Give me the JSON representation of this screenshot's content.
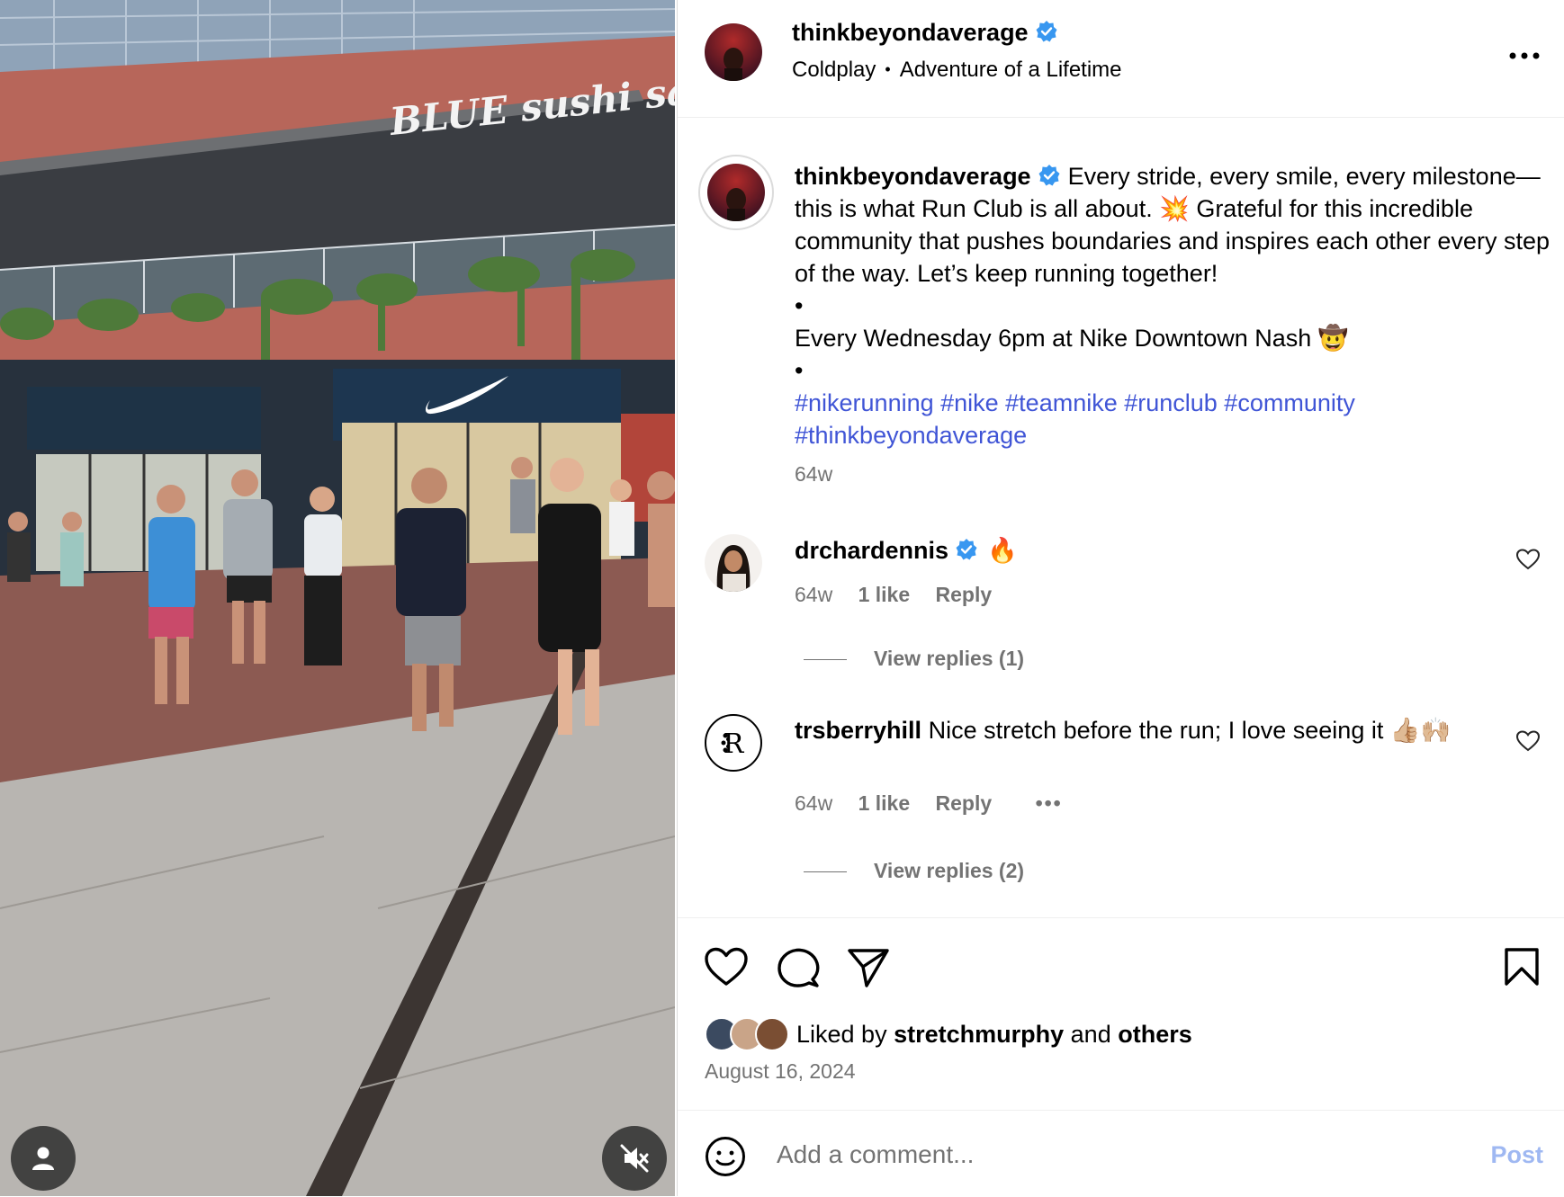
{
  "post": {
    "username": "thinkbeyondaverage",
    "verified": true,
    "audio_artist": "Coldplay",
    "audio_track": "Adventure of a Lifetime",
    "more_icon": "more-horizontal-icon",
    "storefront_sign": "BLUE sushi sake grill",
    "caption": {
      "username": "thinkbeyondaverage",
      "text": "Every stride, every smile, every milestone—this is what Run Club is all about. 💥 Grateful for this incredible community that pushes boundaries and inspires each other every step of the way. Let’s keep running together!",
      "bullet1": "•",
      "line2": "Every Wednesday 6pm at Nike Downtown Nash 🤠",
      "bullet2": "•",
      "hashtags": "#nikerunning #nike #teamnike #runclub #community #thinkbeyondaverage",
      "time": "64w"
    },
    "comments": [
      {
        "username": "drchardennis",
        "verified": true,
        "text": "🔥",
        "time": "64w",
        "likes": "1 like",
        "reply_label": "Reply",
        "view_replies": "View replies (1)"
      },
      {
        "username": "trsberryhill",
        "verified": false,
        "text": "Nice stretch before the run; I love seeing it 👍🏼🙌🏼",
        "time": "64w",
        "likes": "1 like",
        "reply_label": "Reply",
        "more": "•••",
        "view_replies": "View replies (2)"
      }
    ],
    "liked_by_prefix": "Liked by",
    "liked_by_user": "stretchmurphy",
    "liked_by_and": "and",
    "liked_by_others": "others",
    "date": "August 16, 2024",
    "comment_placeholder": "Add a comment...",
    "post_button": "Post"
  },
  "colors": {
    "link_blue": "#4055d6",
    "verified_blue": "#3897f0",
    "muted_text": "#737373",
    "post_button_disabled": "#9fb8f2"
  }
}
